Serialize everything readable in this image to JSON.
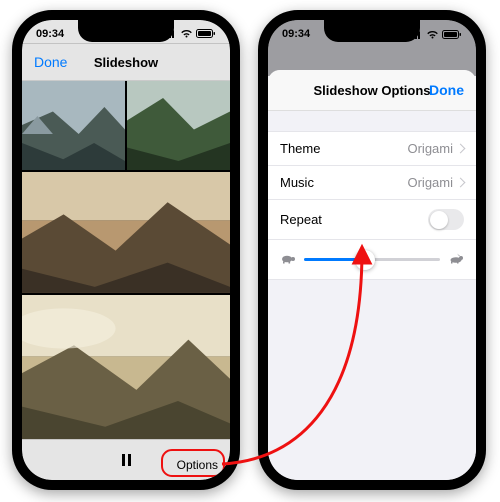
{
  "status": {
    "time": "09:34"
  },
  "left": {
    "nav": {
      "done": "Done",
      "title": "Slideshow"
    },
    "toolbar": {
      "options": "Options"
    }
  },
  "right": {
    "nav": {
      "title": "Slideshow Options",
      "done": "Done"
    },
    "rows": {
      "theme": {
        "label": "Theme",
        "value": "Origami"
      },
      "music": {
        "label": "Music",
        "value": "Origami"
      },
      "repeat": {
        "label": "Repeat",
        "on": false
      }
    },
    "slider": {
      "position_pct": 45
    }
  },
  "colors": {
    "accent": "#007aff",
    "highlight": "#e11"
  }
}
